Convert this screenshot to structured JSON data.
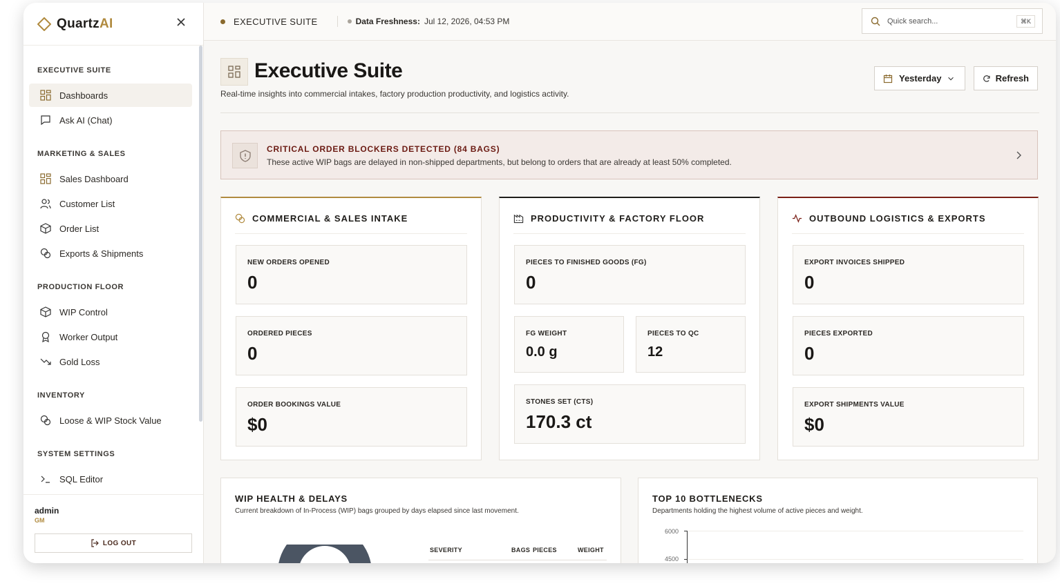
{
  "brand": {
    "name_main": "Quartz",
    "name_accent": "AI"
  },
  "sidebar": {
    "sections": [
      {
        "title": "EXECUTIVE SUITE",
        "items": [
          {
            "label": "Dashboards",
            "icon": "grid-icon",
            "active": true
          },
          {
            "label": "Ask AI (Chat)",
            "icon": "chat-icon"
          }
        ]
      },
      {
        "title": "MARKETING & SALES",
        "items": [
          {
            "label": "Sales Dashboard",
            "icon": "grid-icon"
          },
          {
            "label": "Customer List",
            "icon": "users-icon"
          },
          {
            "label": "Order List",
            "icon": "box-icon"
          },
          {
            "label": "Exports & Shipments",
            "icon": "coins-icon"
          }
        ]
      },
      {
        "title": "PRODUCTION FLOOR",
        "items": [
          {
            "label": "WIP Control",
            "icon": "box-icon"
          },
          {
            "label": "Worker Output",
            "icon": "award-icon"
          },
          {
            "label": "Gold Loss",
            "icon": "trending-down-icon"
          }
        ]
      },
      {
        "title": "INVENTORY",
        "items": [
          {
            "label": "Loose & WIP Stock Value",
            "icon": "coins-icon"
          }
        ]
      },
      {
        "title": "SYSTEM SETTINGS",
        "items": [
          {
            "label": "SQL Editor",
            "icon": "terminal-icon"
          }
        ]
      }
    ],
    "user": {
      "name": "admin",
      "role": "GM"
    },
    "logout_label": "LOG OUT"
  },
  "topbar": {
    "title": "EXECUTIVE SUITE",
    "freshness_label": "Data Freshness:",
    "freshness_value": "Jul 12, 2026, 04:53 PM",
    "search_placeholder": "Quick search...",
    "shortcut": "⌘K"
  },
  "header": {
    "title": "Executive Suite",
    "subtitle": "Real-time insights into commercial intakes, factory production productivity, and logistics activity.",
    "date_filter": "Yesterday",
    "refresh_label": "Refresh"
  },
  "alert": {
    "title": "CRITICAL ORDER BLOCKERS DETECTED (84 BAGS)",
    "text": "These active WIP bags are delayed in non-shipped departments, but belong to orders that are already at least 50% completed."
  },
  "columns": {
    "commercial": {
      "title": "COMMERCIAL & SALES INTAKE",
      "accent": "#b08a3e",
      "cards": [
        {
          "label": "NEW ORDERS OPENED",
          "value": "0"
        },
        {
          "label": "ORDERED PIECES",
          "value": "0"
        },
        {
          "label": "ORDER BOOKINGS VALUE",
          "value": "$0"
        }
      ]
    },
    "productivity": {
      "title": "PRODUCTIVITY & FACTORY FLOOR",
      "accent": "#1f1d1a",
      "cards": [
        {
          "label": "PIECES TO FINISHED GOODS (FG)",
          "value": "0"
        },
        {
          "label": "FG WEIGHT",
          "value": "0.0 g"
        },
        {
          "label": "PIECES TO QC",
          "value": "12"
        },
        {
          "label": "STONES SET (CTS)",
          "value": "170.3 ct"
        }
      ]
    },
    "logistics": {
      "title": "OUTBOUND LOGISTICS & EXPORTS",
      "accent": "#7a1f16",
      "cards": [
        {
          "label": "EXPORT INVOICES SHIPPED",
          "value": "0"
        },
        {
          "label": "PIECES EXPORTED",
          "value": "0"
        },
        {
          "label": "EXPORT SHIPMENTS VALUE",
          "value": "$0"
        }
      ]
    }
  },
  "wip_panel": {
    "title": "WIP HEALTH & DELAYS",
    "subtitle": "Current breakdown of In-Process (WIP) bags grouped by days elapsed since last movement.",
    "columns": [
      "SEVERITY",
      "BAGS",
      "PIECES",
      "WEIGHT"
    ]
  },
  "bottleneck_panel": {
    "title": "TOP 10 BOTTLENECKS",
    "subtitle": "Departments holding the highest volume of active pieces and weight.",
    "y_ticks": [
      "6000",
      "4500"
    ]
  },
  "colors": {
    "accent_gold": "#b08a3e",
    "alert_red": "#6b1a12",
    "status_dot": "#8a6a2e"
  }
}
